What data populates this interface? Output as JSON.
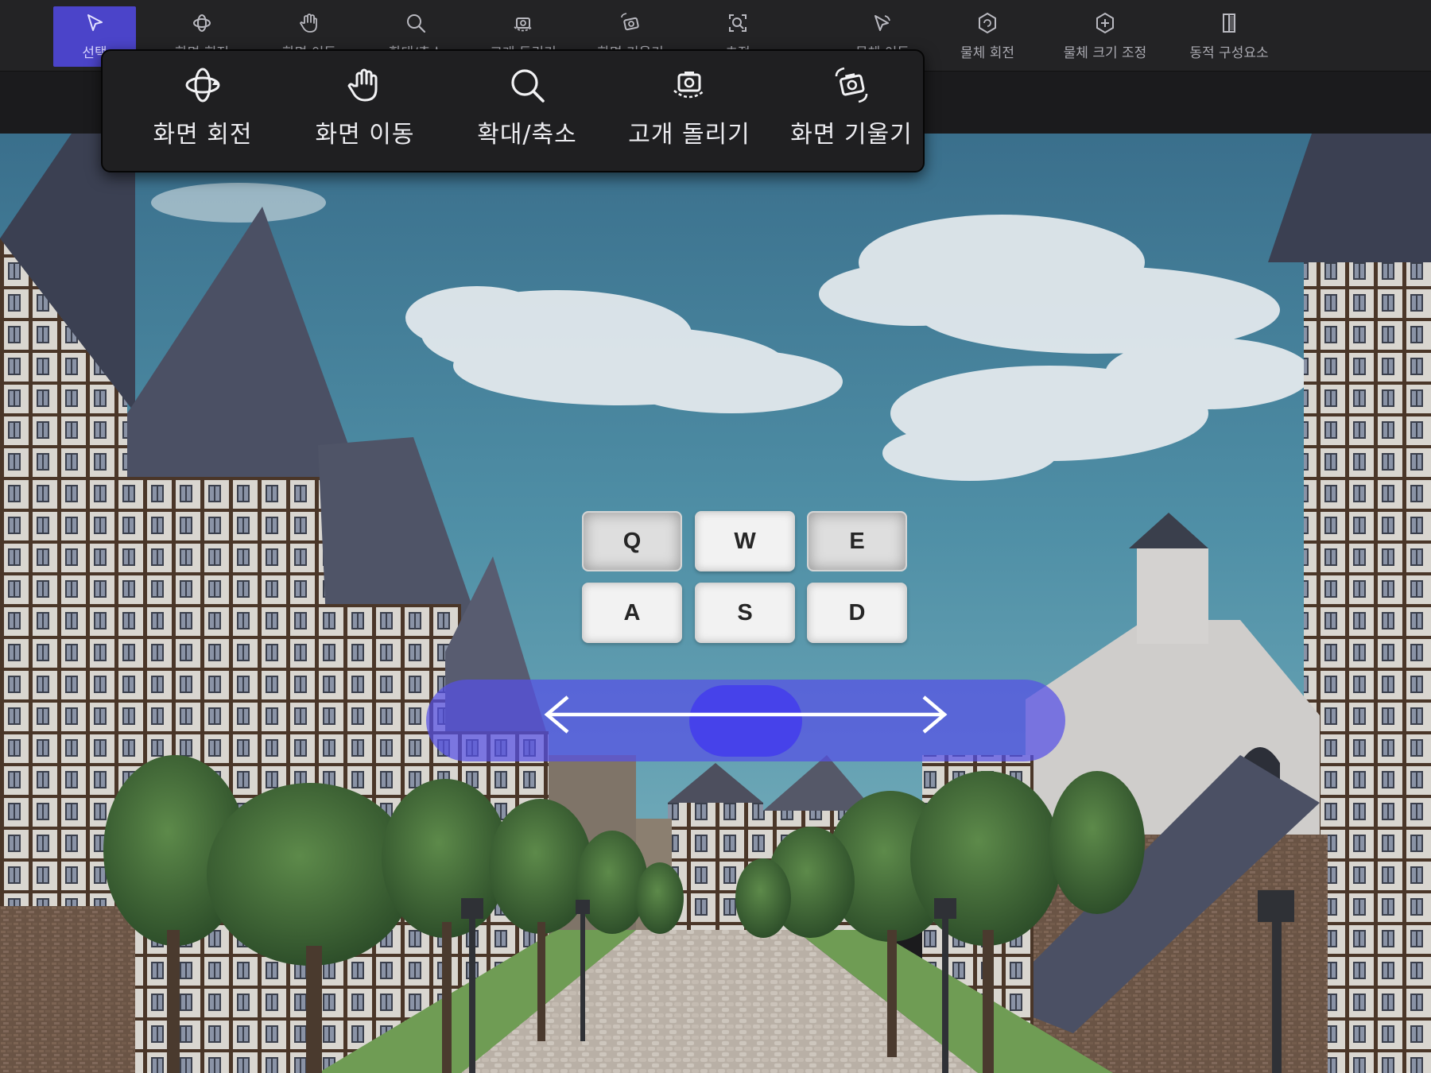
{
  "toolbar": {
    "tools": [
      {
        "id": "select",
        "label": "선택",
        "icon": "cursor-arrow-icon",
        "active": true
      },
      {
        "id": "orbit",
        "label": "화면 회전",
        "icon": "orbit-icon"
      },
      {
        "id": "pan",
        "label": "화면 이동",
        "icon": "hand-icon"
      },
      {
        "id": "zoom",
        "label": "확대/축소",
        "icon": "magnifier-icon"
      },
      {
        "id": "look",
        "label": "고개 돌리기",
        "icon": "camera-turn-icon"
      },
      {
        "id": "tilt",
        "label": "화면 기울기",
        "icon": "camera-tilt-icon"
      },
      {
        "id": "focus",
        "label": "초점",
        "icon": "focus-icon"
      },
      {
        "id": "move-object",
        "label": "물체 이동",
        "icon": "cursor-move-icon"
      },
      {
        "id": "rotate-object",
        "label": "물체 회전",
        "icon": "rotate-object-icon"
      },
      {
        "id": "scale-object",
        "label": "물체 크기 조정",
        "icon": "scale-object-icon"
      },
      {
        "id": "dynamic",
        "label": "동적 구성요소",
        "icon": "door-icon"
      }
    ]
  },
  "popup": {
    "items": [
      {
        "label": "화면 회전",
        "icon": "orbit-icon"
      },
      {
        "label": "화면 이동",
        "icon": "hand-icon"
      },
      {
        "label": "확대/축소",
        "icon": "magnifier-icon"
      },
      {
        "label": "고개 돌리기",
        "icon": "camera-turn-icon"
      },
      {
        "label": "화면 기울기",
        "icon": "camera-tilt-icon"
      }
    ]
  },
  "keys": {
    "q": "Q",
    "w": "W",
    "e": "E",
    "a": "A",
    "s": "S",
    "d": "D",
    "pressed": [
      "Q",
      "E"
    ]
  },
  "slider": {
    "value": 0.5
  },
  "colors": {
    "accent": "#4b44c9",
    "slider": "#5650e6",
    "toolbar_bg": "#232325",
    "popup_bg": "#1f1f21"
  }
}
